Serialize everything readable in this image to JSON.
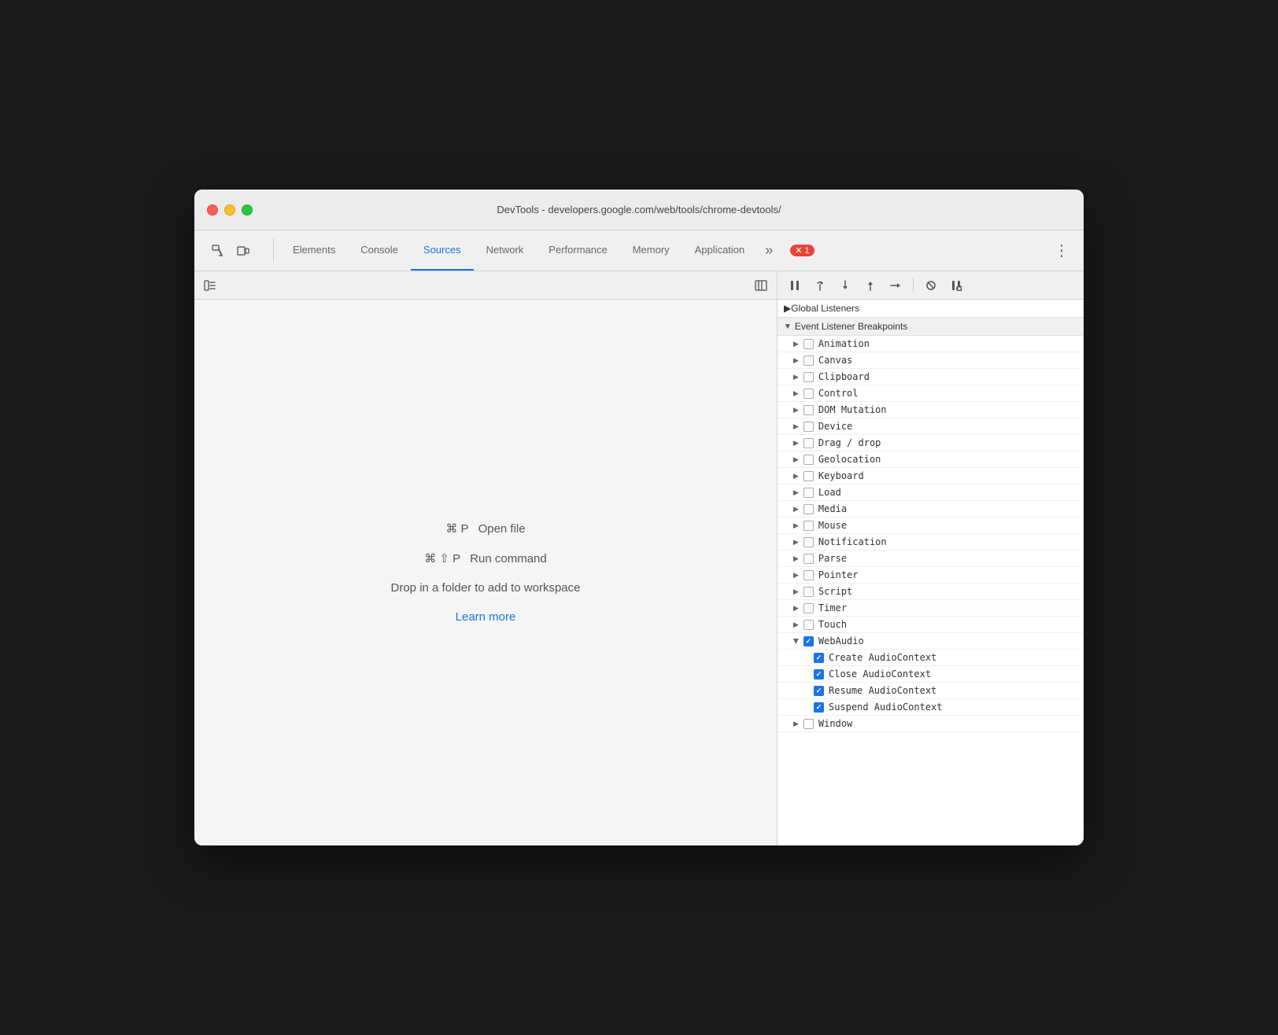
{
  "window": {
    "title": "DevTools - developers.google.com/web/tools/chrome-devtools/"
  },
  "tabs": {
    "items": [
      {
        "id": "elements",
        "label": "Elements",
        "active": false
      },
      {
        "id": "console",
        "label": "Console",
        "active": false
      },
      {
        "id": "sources",
        "label": "Sources",
        "active": true
      },
      {
        "id": "network",
        "label": "Network",
        "active": false
      },
      {
        "id": "performance",
        "label": "Performance",
        "active": false
      },
      {
        "id": "memory",
        "label": "Memory",
        "active": false
      },
      {
        "id": "application",
        "label": "Application",
        "active": false
      }
    ],
    "more_label": "»",
    "error_count": "1",
    "menu_icon": "⋮"
  },
  "sources": {
    "shortcut1_key": "⌘ P",
    "shortcut1_label": "Open file",
    "shortcut2_key": "⌘ ⇧ P",
    "shortcut2_label": "Run command",
    "drop_text": "Drop in a folder to add to workspace",
    "learn_more": "Learn more"
  },
  "debugger": {
    "pause_label": "⏸",
    "step_over_label": "↪",
    "step_into_label": "↓",
    "step_out_label": "↑",
    "step_label": "→",
    "deactivate_label": "⊘",
    "pause_exceptions_label": "⏸"
  },
  "breakpoints": {
    "global_listeners_label": "Global Listeners",
    "event_listener_label": "Event Listener Breakpoints",
    "items": [
      {
        "id": "animation",
        "label": "Animation",
        "checked": false,
        "expanded": false
      },
      {
        "id": "canvas",
        "label": "Canvas",
        "checked": false,
        "expanded": false
      },
      {
        "id": "clipboard",
        "label": "Clipboard",
        "checked": false,
        "expanded": false
      },
      {
        "id": "control",
        "label": "Control",
        "checked": false,
        "expanded": false
      },
      {
        "id": "dom-mutation",
        "label": "DOM Mutation",
        "checked": false,
        "expanded": false
      },
      {
        "id": "device",
        "label": "Device",
        "checked": false,
        "expanded": false
      },
      {
        "id": "drag-drop",
        "label": "Drag / drop",
        "checked": false,
        "expanded": false
      },
      {
        "id": "geolocation",
        "label": "Geolocation",
        "checked": false,
        "expanded": false
      },
      {
        "id": "keyboard",
        "label": "Keyboard",
        "checked": false,
        "expanded": false
      },
      {
        "id": "load",
        "label": "Load",
        "checked": false,
        "expanded": false
      },
      {
        "id": "media",
        "label": "Media",
        "checked": false,
        "expanded": false
      },
      {
        "id": "mouse",
        "label": "Mouse",
        "checked": false,
        "expanded": false
      },
      {
        "id": "notification",
        "label": "Notification",
        "checked": false,
        "expanded": false
      },
      {
        "id": "parse",
        "label": "Parse",
        "checked": false,
        "expanded": false
      },
      {
        "id": "pointer",
        "label": "Pointer",
        "checked": false,
        "expanded": false
      },
      {
        "id": "script",
        "label": "Script",
        "checked": false,
        "expanded": false
      },
      {
        "id": "timer",
        "label": "Timer",
        "checked": false,
        "expanded": false
      },
      {
        "id": "touch",
        "label": "Touch",
        "checked": false,
        "expanded": false
      },
      {
        "id": "webaudio",
        "label": "WebAudio",
        "checked": true,
        "expanded": true
      },
      {
        "id": "window",
        "label": "Window",
        "checked": false,
        "expanded": false
      }
    ],
    "webaudio_subitems": [
      {
        "id": "create-audio",
        "label": "Create AudioContext",
        "checked": true
      },
      {
        "id": "close-audio",
        "label": "Close AudioContext",
        "checked": true
      },
      {
        "id": "resume-audio",
        "label": "Resume AudioContext",
        "checked": true
      },
      {
        "id": "suspend-audio",
        "label": "Suspend AudioContext",
        "checked": true
      }
    ]
  }
}
